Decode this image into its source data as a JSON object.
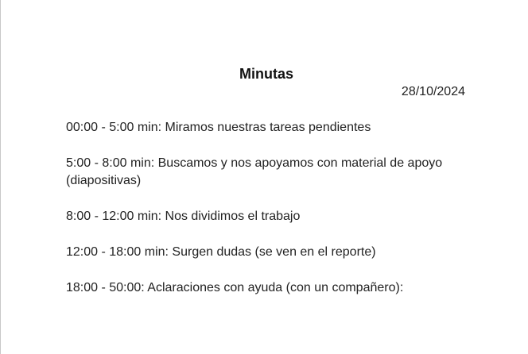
{
  "document": {
    "title": "Minutas",
    "date": "28/10/2024",
    "entries": [
      {
        "text": "00:00 - 5:00 min: Miramos nuestras tareas pendientes"
      },
      {
        "text": "5:00 - 8:00 min: Buscamos y nos apoyamos con material de apoyo (diapositivas)"
      },
      {
        "text": "8:00 - 12:00 min: Nos dividimos el trabajo"
      },
      {
        "text": "12:00 - 18:00 min: Surgen dudas (se ven en el reporte)"
      },
      {
        "text": "18:00 - 50:00: Aclaraciones con ayuda (con un compañero):"
      }
    ]
  }
}
